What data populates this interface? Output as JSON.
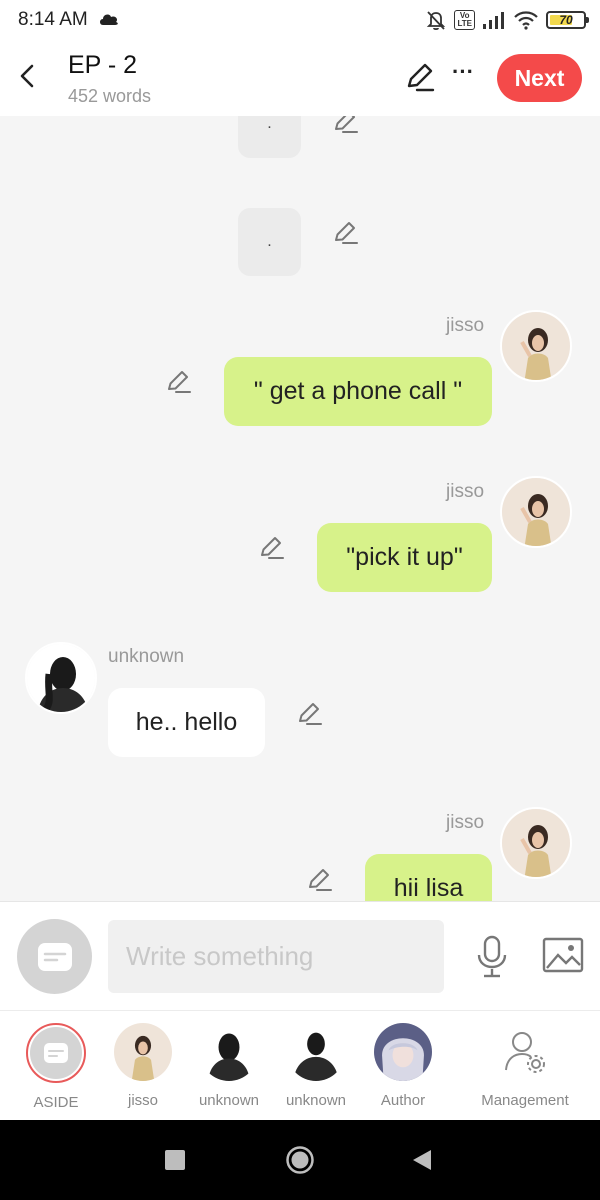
{
  "status_bar": {
    "time": "8:14 AM",
    "cloud_icon": "cloud-icon",
    "lte_top": "Vo",
    "lte_bottom": "LTE",
    "battery": "70"
  },
  "header": {
    "title": "EP - 2",
    "word_count": "452 words",
    "next_label": "Next",
    "more_label": "···",
    "back_icon": "chevron-left-icon",
    "edit_icon": "pencil-icon",
    "accent_color": "#f44a4a"
  },
  "messages": [
    {
      "type": "aside",
      "text": "."
    },
    {
      "type": "aside",
      "text": "."
    },
    {
      "sender": "jisso",
      "side": "right",
      "text": "\" get a phone call \""
    },
    {
      "sender": "jisso",
      "side": "right",
      "text": "\"pick it up\""
    },
    {
      "sender": "unknown",
      "side": "left",
      "text": "he.. hello"
    },
    {
      "sender": "jisso",
      "side": "right",
      "text": "hii lisa"
    }
  ],
  "composer": {
    "placeholder": "Write something",
    "mic_icon": "microphone-icon",
    "image_icon": "image-icon",
    "aside_icon": "aside-icon"
  },
  "characters": [
    {
      "label": "ASIDE",
      "selected": true
    },
    {
      "label": "jisso"
    },
    {
      "label": "unknown"
    },
    {
      "label": "unknown"
    },
    {
      "label": "Author"
    },
    {
      "label": "Management"
    }
  ],
  "colors": {
    "my_bubble": "#d7f28a",
    "other_bubble": "#ffffff",
    "aside_bubble": "#ebebeb"
  }
}
